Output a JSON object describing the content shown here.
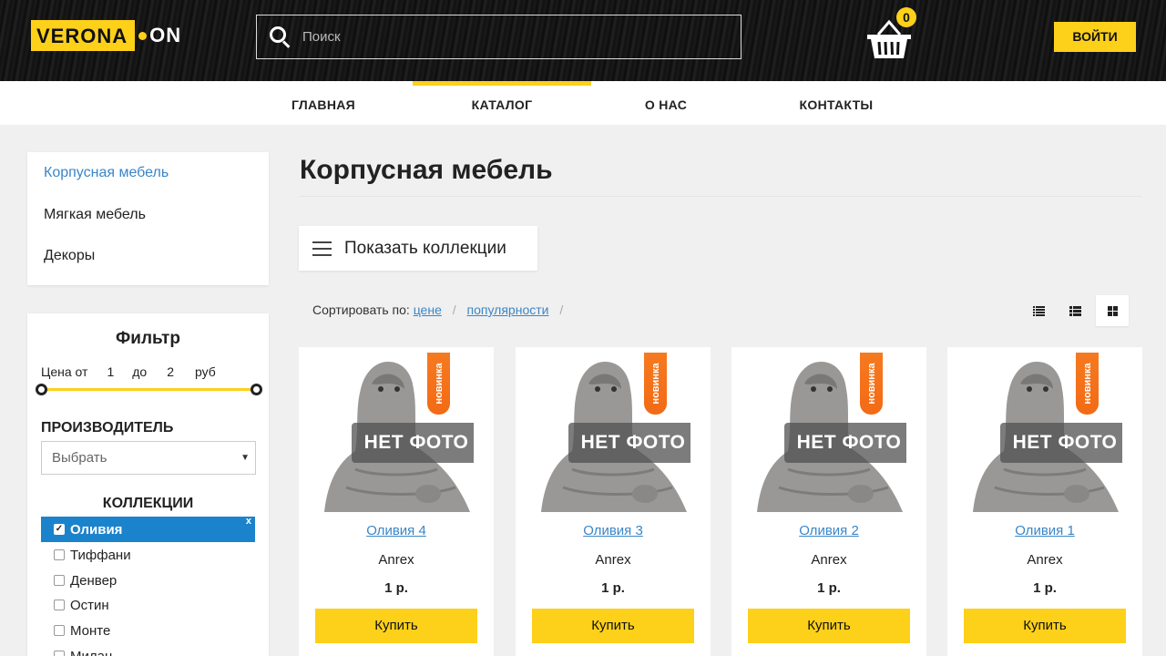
{
  "header": {
    "logo_main": "VERONA",
    "logo_suffix": "ON",
    "search_placeholder": "Поиск",
    "cart_count": "0",
    "login_label": "ВОЙТИ"
  },
  "nav": {
    "items": [
      {
        "label": "ГЛАВНАЯ",
        "active": false
      },
      {
        "label": "КАТАЛОГ",
        "active": true
      },
      {
        "label": "О НАС",
        "active": false
      },
      {
        "label": "КОНТАКТЫ",
        "active": false
      }
    ]
  },
  "categories": [
    {
      "label": "Корпусная мебель",
      "active": true
    },
    {
      "label": "Мягкая мебель",
      "active": false
    },
    {
      "label": "Декоры",
      "active": false
    }
  ],
  "filter": {
    "title": "Фильтр",
    "price_from_label": "Цена от",
    "price_from": "1",
    "price_to_label": "до",
    "price_to": "2",
    "currency": "руб",
    "manufacturer_title": "ПРОИЗВОДИТЕЛЬ",
    "manufacturer_value": "Выбрать",
    "collections_title": "КОЛЛЕКЦИИ",
    "collections": [
      {
        "label": "Оливия",
        "checked": true
      },
      {
        "label": "Тиффани",
        "checked": false
      },
      {
        "label": "Денвер",
        "checked": false
      },
      {
        "label": "Остин",
        "checked": false
      },
      {
        "label": "Монте",
        "checked": false
      },
      {
        "label": "Милан",
        "checked": false
      }
    ],
    "clear_label": "x"
  },
  "main": {
    "title": "Корпусная мебель",
    "show_collections_label": "Показать коллекции",
    "sort_label": "Сортировать по:",
    "sort_price": "цене",
    "sort_popularity": "популярности",
    "sort_sep": "/"
  },
  "products": [
    {
      "name": "Оливия 4",
      "brand": "Anrex",
      "price": "1 р.",
      "badge": "новинка",
      "no_photo": "НЕТ ФОТО",
      "buy": "Купить"
    },
    {
      "name": "Оливия 3",
      "brand": "Anrex",
      "price": "1 р.",
      "badge": "новинка",
      "no_photo": "НЕТ ФОТО",
      "buy": "Купить"
    },
    {
      "name": "Оливия 2",
      "brand": "Anrex",
      "price": "1 р.",
      "badge": "новинка",
      "no_photo": "НЕТ ФОТО",
      "buy": "Купить"
    },
    {
      "name": "Оливия 1",
      "brand": "Anrex",
      "price": "1 р.",
      "badge": "новинка",
      "no_photo": "НЕТ ФОТО",
      "buy": "Купить"
    }
  ],
  "colors": {
    "accent": "#fdd01a",
    "link": "#3a86c8",
    "badge": "#f57a20",
    "selected": "#1b83cc"
  }
}
